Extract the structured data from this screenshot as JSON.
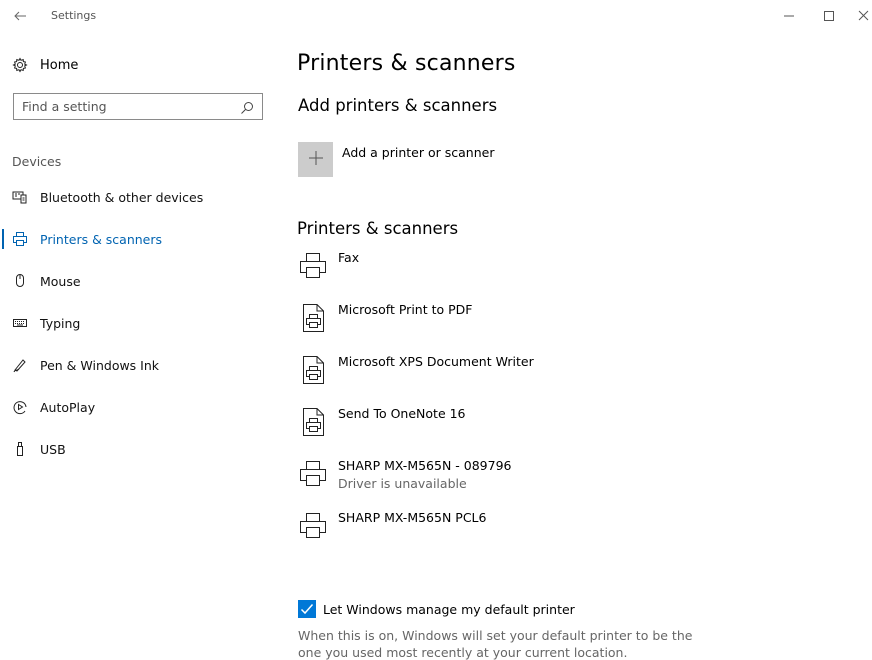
{
  "window": {
    "title": "Settings"
  },
  "sidebar": {
    "home_label": "Home",
    "search_placeholder": "Find a setting",
    "section_label": "Devices",
    "items": [
      {
        "label": "Bluetooth & other devices",
        "icon": "bluetooth-devices-icon",
        "active": false
      },
      {
        "label": "Printers & scanners",
        "icon": "printer-icon",
        "active": true
      },
      {
        "label": "Mouse",
        "icon": "mouse-icon",
        "active": false
      },
      {
        "label": "Typing",
        "icon": "keyboard-icon",
        "active": false
      },
      {
        "label": "Pen & Windows Ink",
        "icon": "pen-icon",
        "active": false
      },
      {
        "label": "AutoPlay",
        "icon": "autoplay-icon",
        "active": false
      },
      {
        "label": "USB",
        "icon": "usb-icon",
        "active": false
      }
    ]
  },
  "main": {
    "title": "Printers & scanners",
    "add_section_title": "Add printers & scanners",
    "add_label": "Add a printer or scanner",
    "list_title": "Printers & scanners",
    "printers": [
      {
        "name": "Fax",
        "status": "",
        "icon": "printer-icon"
      },
      {
        "name": "Microsoft Print to PDF",
        "status": "",
        "icon": "document-printer-icon"
      },
      {
        "name": "Microsoft XPS Document Writer",
        "status": "",
        "icon": "document-printer-icon"
      },
      {
        "name": "Send To OneNote 16",
        "status": "",
        "icon": "document-printer-icon"
      },
      {
        "name": "SHARP MX-M565N - 089796",
        "status": "Driver is unavailable",
        "icon": "printer-icon"
      },
      {
        "name": "SHARP MX-M565N PCL6",
        "status": "",
        "icon": "printer-icon"
      }
    ],
    "default_printer_checkbox": {
      "label": "Let Windows manage my default printer",
      "checked": true,
      "description": "When this is on, Windows will set your default printer to be the one you used most recently at your current location."
    }
  },
  "colors": {
    "accent": "#0078d7",
    "active_text": "#0063b1",
    "add_tile": "#cccccc"
  }
}
